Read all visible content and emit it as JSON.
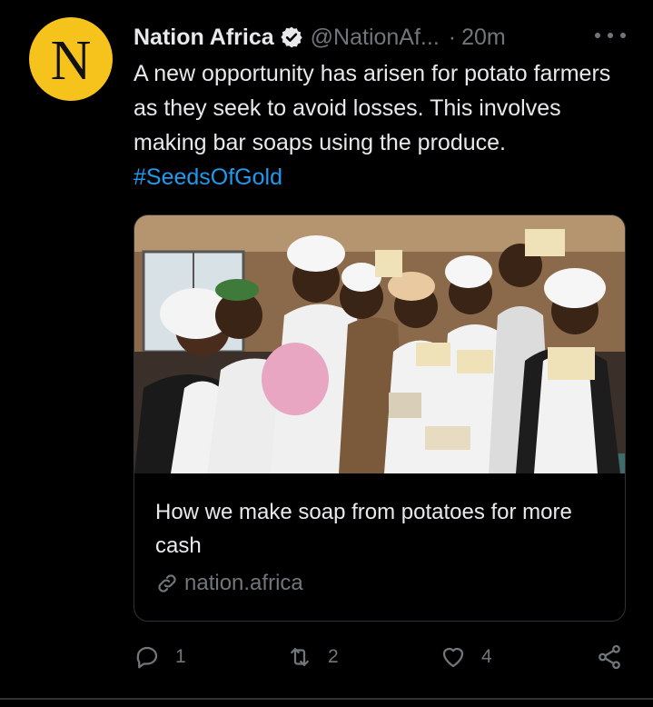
{
  "tweet": {
    "avatar_letter": "N",
    "display_name": "Nation Africa",
    "handle": "@NationAf...",
    "separator": "·",
    "time": "20m",
    "text": "A new opportunity has arisen for potato farmers as they seek to avoid losses. This involves making bar soaps using the produce.",
    "hashtag": "#SeedsOfGold"
  },
  "card": {
    "title": "How we make soap from potatoes for more cash",
    "domain": "nation.africa",
    "image_alt": "Women in aprons and hairnets holding up bars of potato soap"
  },
  "actions": {
    "reply_count": "1",
    "retweet_count": "2",
    "like_count": "4"
  },
  "colors": {
    "avatar_bg": "#f6c21c",
    "link": "#1d9bf0",
    "muted": "#71767b",
    "background": "#000000"
  }
}
